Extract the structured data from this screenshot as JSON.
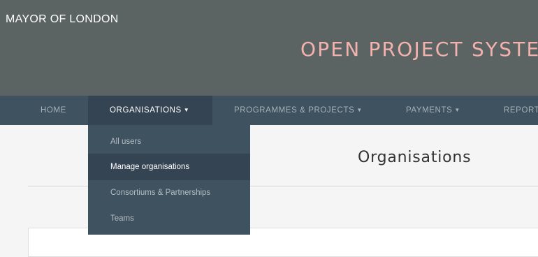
{
  "header": {
    "brand": "MAYOR OF LONDON",
    "system_title": "OPEN PROJECT SYSTEM"
  },
  "nav": {
    "home": "HOME",
    "organisations": "ORGANISATIONS",
    "programmes": "PROGRAMMES & PROJECTS",
    "payments": "PAYMENTS",
    "reports": "REPORT",
    "caret": "▼"
  },
  "dropdown": {
    "items": [
      "All users",
      "Manage organisations",
      "Consortiums & Partnerships",
      "Teams"
    ]
  },
  "page": {
    "title": "Organisations"
  },
  "colors": {
    "header_bg": "#5b6462",
    "nav_bg": "#3f5260",
    "nav_active": "#344452",
    "accent_title": "#f3b2ad"
  }
}
